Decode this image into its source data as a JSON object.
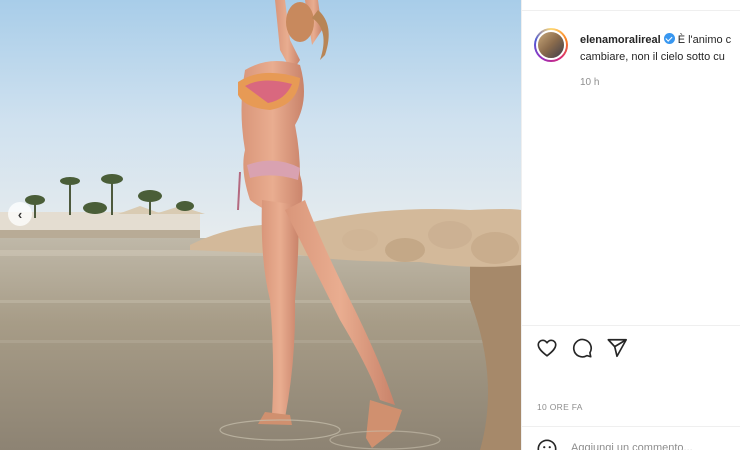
{
  "post": {
    "username": "elenamoralireal",
    "verified": true,
    "caption_line1": "È l'animo c",
    "caption_line2": "cambiare, non il cielo sotto cu",
    "caption_time": "10 h",
    "date": "10 ORE FA"
  },
  "comment": {
    "placeholder": "Aggiungi un commento..."
  },
  "icons": {
    "like": "heart-icon",
    "comment": "comment-icon",
    "share": "send-icon",
    "emoji": "emoji-icon",
    "prev": "chevron-left-icon"
  },
  "colors": {
    "verified": "#3897f0",
    "text": "#262626",
    "muted": "#8e8e8e"
  }
}
